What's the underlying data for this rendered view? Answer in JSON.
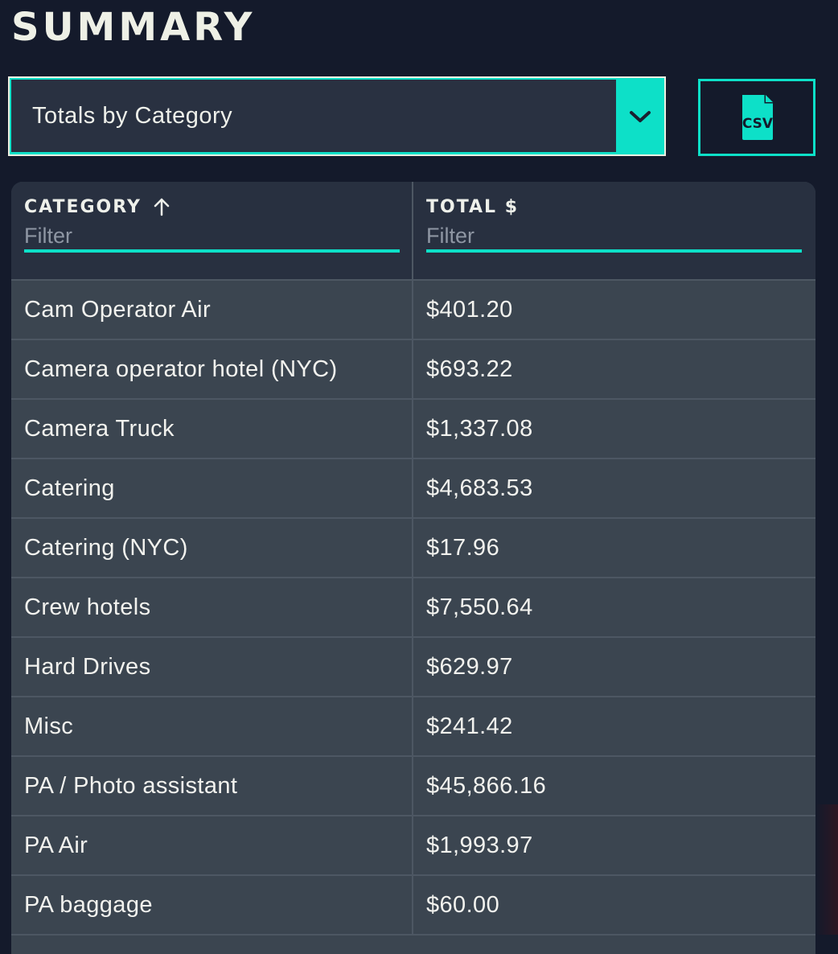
{
  "page": {
    "title": "SUMMARY"
  },
  "view_select": {
    "value": "Totals by Category",
    "arrow_icon": "chevron-down-icon"
  },
  "export": {
    "icon": "csv-file-icon",
    "icon_text": "CSV"
  },
  "table": {
    "columns": [
      {
        "label": "CATEGORY",
        "sort": "ascending",
        "sort_icon": "arrow-up-icon",
        "filter_placeholder": "Filter"
      },
      {
        "label": "TOTAL $",
        "filter_placeholder": "Filter"
      }
    ],
    "rows": [
      {
        "category": "Cam Operator Air",
        "total": "$401.20"
      },
      {
        "category": "Camera operator hotel (NYC)",
        "total": "$693.22"
      },
      {
        "category": "Camera Truck",
        "total": "$1,337.08"
      },
      {
        "category": "Catering",
        "total": "$4,683.53"
      },
      {
        "category": "Catering (NYC)",
        "total": "$17.96"
      },
      {
        "category": "Crew hotels",
        "total": "$7,550.64"
      },
      {
        "category": "Hard Drives",
        "total": "$629.97"
      },
      {
        "category": "Misc",
        "total": "$241.42"
      },
      {
        "category": "PA / Photo assistant",
        "total": "$45,866.16"
      },
      {
        "category": "PA Air",
        "total": "$1,993.97"
      },
      {
        "category": "PA baggage",
        "total": "$60.00"
      }
    ]
  },
  "colors": {
    "background": "#141a2b",
    "accent": "#0de0c8",
    "header_bg": "#283040",
    "row_bg": "#3b4550"
  }
}
